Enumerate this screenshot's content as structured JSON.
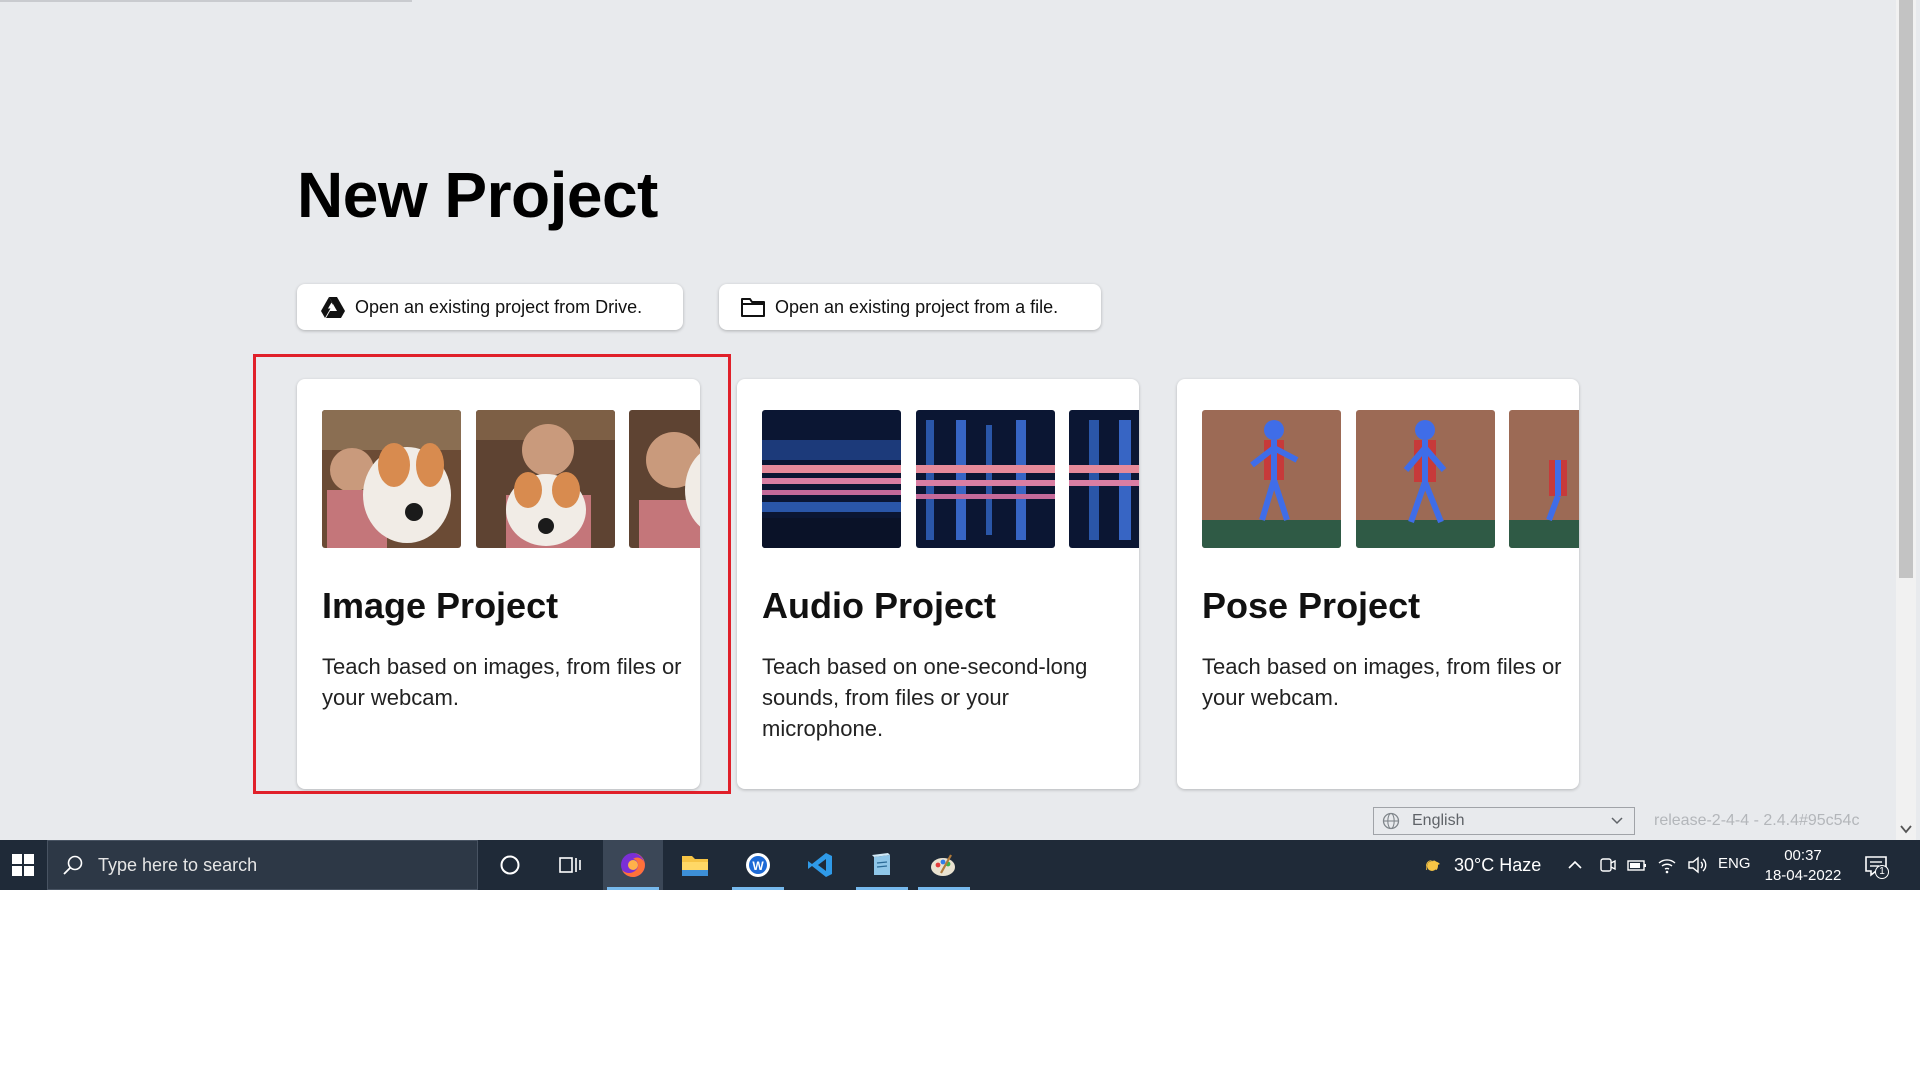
{
  "page": {
    "title": "New Project"
  },
  "open_buttons": {
    "drive": "Open an existing project from Drive.",
    "file": "Open an existing project from a file."
  },
  "cards": [
    {
      "title": "Image Project",
      "description": "Teach based on images, from files or your webcam."
    },
    {
      "title": "Audio Project",
      "description": "Teach based on one-second-long sounds, from files or your microphone."
    },
    {
      "title": "Pose Project",
      "description": "Teach based on images, from files or your webcam."
    }
  ],
  "footer": {
    "language": "English",
    "release": "release-2-4-4 - 2.4.4#95c54c"
  },
  "taskbar": {
    "search_placeholder": "Type here to search",
    "weather": "30°C  Haze",
    "input_lang": "ENG",
    "time": "00:37",
    "date": "18-04-2022",
    "notification_count": "1",
    "apps": [
      "firefox-icon",
      "file-explorer-icon",
      "writer-app-icon",
      "vscode-icon",
      "notepad-app-icon",
      "paint-app-icon"
    ]
  },
  "colors": {
    "background": "#e8eaed",
    "highlight": "#e0202a",
    "taskbar": "#1f2a38",
    "taskbar_active_underline": "#76b9ed"
  }
}
